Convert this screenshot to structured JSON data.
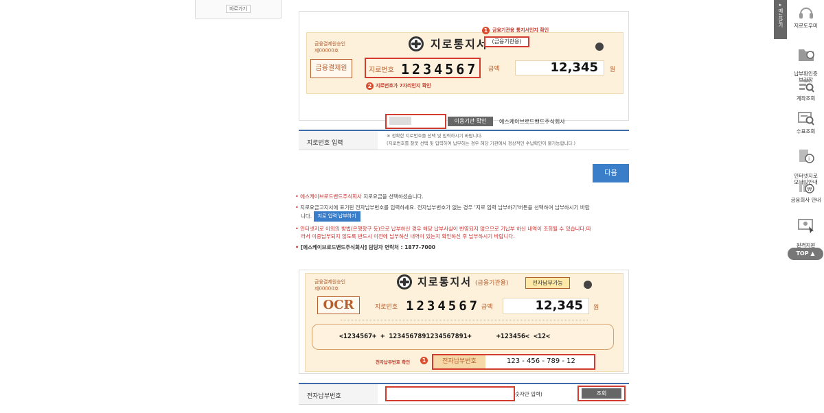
{
  "left_panel": {
    "shortcut_label": "바로가기"
  },
  "bill1": {
    "approval": "금융결제원승인",
    "approval_no": "제00000호",
    "title": "지로통지서",
    "sub_title": "(금융기관용)",
    "org": "금융결제원",
    "giro_label": "지로번호",
    "giro_number": "1234567",
    "amount_label": "금액",
    "amount": "12,345",
    "currency": "원",
    "callout1_no": "1",
    "callout1": "금융기관용 통지서인지 확인",
    "callout2_no": "2",
    "callout2": "지로번호가 7자리인지 확인"
  },
  "giro_form": {
    "label": "지로번호 입력",
    "check_button": "이용기관 확인",
    "org_name": "에스케이브로드밴드주식회사",
    "help1": "※ 정확한 지로번호를 선택 및 입력하시기 바랍니다.",
    "help2": "(지로번호를 잘못 선택 및 입력하여 납부하는 경우 해당 기관에서 정상적인 수납확인이 불가능합니다.)"
  },
  "next_button": "다음",
  "notices": {
    "n1_red": "에스케이브로드밴드주식회사",
    "n1_rest": " 지로요금을 선택하셨습니다.",
    "n2_line1": "지로요금고지서에 표기된 전자납부번호를 입력하세요. 전자납부번호가 없는 경우 '지로 입력 납부하기'버튼을 선택하여 납부하시기 바랍",
    "n2_line2": "니다.",
    "n2_button": "지로 입력 납부하기",
    "n3_line1": "인터넷지로 이외의 방법(은행창구 등)으로 납부하신 경우 해당 납부사실이 반영되지 않으므로 기납부 하신 내역이 조회될 수 있습니다.따",
    "n3_line2": "라서 이중납부되지 않도록 반드시 이전에 납부하신 내역이 있는지 확인하신 후 납부하시기 바랍니다.",
    "n4": "[에스케이브로드밴드주식회사] 담당자 연락처 : 1877-7000"
  },
  "bill2": {
    "approval": "금융결제원승인",
    "approval_no": "제00000호",
    "title": "지로통지서",
    "sub_title": "(금융기관용)",
    "epay_badge": "전자납부가능",
    "ocr": "OCR",
    "giro_label": "지로번호",
    "giro_number": "1234567",
    "amount_label": "금액",
    "amount": "12,345",
    "currency": "원",
    "ocr_line": "<1234567+ + 1234567891234567891+      +123456< <12<",
    "callout_label": "전자납부번호 확인",
    "callout_no": "1",
    "epay_label": "전자납부번호",
    "epay_number": "123 - 456 - 789 - 12"
  },
  "epay_form": {
    "label": "전자납부번호",
    "hint": "숫자만 입력)",
    "search_button": "조회"
  },
  "sidebar": {
    "menu_close": "메뉴닫기",
    "items": [
      {
        "label": "지로도우미"
      },
      {
        "label": "납부확인증\n보관함"
      },
      {
        "label": "계좌조회"
      },
      {
        "label": "수표조회"
      },
      {
        "label": "인터넷지로\n모바일안내"
      },
      {
        "label": "금융회사 안내"
      },
      {
        "label": "원격지원\n서비스"
      }
    ],
    "top_button": "TOP ▲"
  }
}
